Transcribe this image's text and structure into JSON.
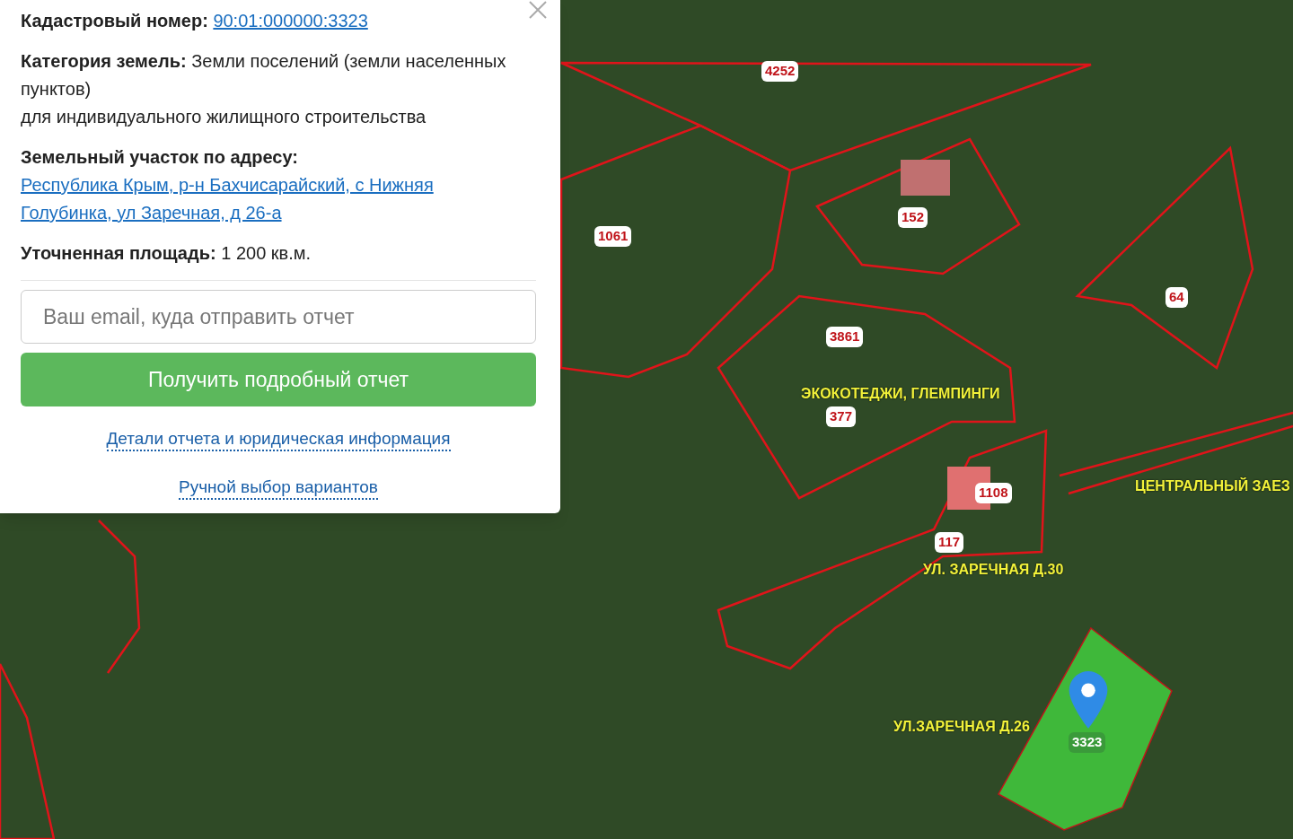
{
  "popup": {
    "fields": [
      {
        "label": "Кадастровый номер:",
        "value": "90:01:000000:3323",
        "kind": "link"
      },
      {
        "label": "Категория земель:",
        "value": "Земли поселений (земли населенных пунктов)",
        "extra": "для индивидуального жилищного строительства",
        "kind": "text"
      },
      {
        "label": "Земельный участок по адресу:",
        "value": "Республика Крым, р-н Бахчисарайский, с Нижняя Голубинка, ул Заречная, д 26-а",
        "kind": "link"
      },
      {
        "label": "Уточненная площадь:",
        "value": "1 200 кв.м.",
        "kind": "text"
      }
    ],
    "email": {
      "placeholder": "Ваш email, куда отправить отчет"
    },
    "submit": "Получить подробный отчет",
    "links": [
      "Детали отчета и юридическая информация",
      "Ручной выбор вариантов"
    ]
  },
  "map": {
    "labels": [
      {
        "text": "4252",
        "kind": "parcel"
      },
      {
        "text": "1061",
        "kind": "parcel"
      },
      {
        "text": "152",
        "kind": "parcel"
      },
      {
        "text": "3861",
        "kind": "parcel"
      },
      {
        "text": "64",
        "kind": "parcel"
      },
      {
        "text": "ЭКОКОТЕДЖИ, ГЛЕМПИНГИ",
        "kind": "note"
      },
      {
        "text": "377",
        "kind": "parcel"
      },
      {
        "text": "ЦЕНТРАЛЬНЫЙ ЗАЕЗ",
        "kind": "note"
      },
      {
        "text": "1108",
        "kind": "parcel"
      },
      {
        "text": "117",
        "kind": "parcel"
      },
      {
        "text": "УЛ. ЗАРЕЧНАЯ Д.30",
        "kind": "note"
      },
      {
        "text": "УЛ.ЗАРЕЧНАЯ Д.26",
        "kind": "note"
      },
      {
        "text": "3323",
        "kind": "selected"
      }
    ]
  }
}
